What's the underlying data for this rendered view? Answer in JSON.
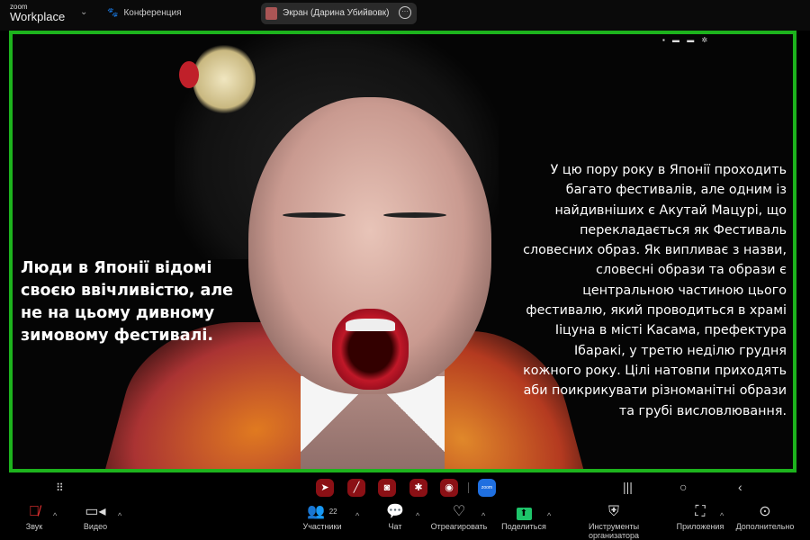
{
  "topbar": {
    "logo_small": "zoom",
    "logo_big": "Workplace",
    "conference_label": "Конференция",
    "screen_share_label": "Экран (Дарина Убийвовк)"
  },
  "slide": {
    "left_text": "Люди в Японії відомі своєю ввічливістю, але не на цьому дивному зимовому фестивалі.",
    "right_text": "У цю пору року в Японії проходить багато фестивалів, але одним із найдивніших є Акутай Мацурі, що перекладається як Фестиваль словесних образ. Як випливає з назви, словесні образи та образи є центральною частиною цього фестивалю, який проводиться в храмі Ііцуна в місті Касама, префектура Ібаракі, у третю неділю грудня кожного року. Цілі натовпи приходять аби поикрикувати різноманітні образи та грубі висловлювання."
  },
  "navbar": {
    "apps": [
      "telegram-icon",
      "brush-icon",
      "instagram-icon",
      "flower-icon",
      "camera-icon",
      "zoom-icon"
    ],
    "zoom_app_label": "zoom"
  },
  "toolbar": {
    "audio": "Звук",
    "video": "Видео",
    "participants": "Участники",
    "participants_count": "22",
    "chat": "Чат",
    "react": "Отреагировать",
    "share": "Поделиться",
    "host_tools": "Инструменты организатора",
    "apps": "Приложения",
    "more": "Дополнительно"
  },
  "colors": {
    "share_border": "#1db31d",
    "share_button": "#1ec46a",
    "app_red": "#8b1015",
    "zoom_blue": "#1f6fe0"
  }
}
